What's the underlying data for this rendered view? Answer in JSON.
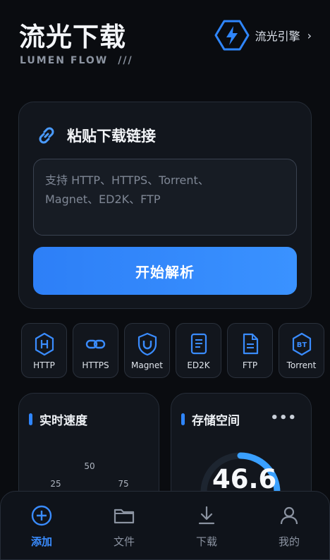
{
  "header": {
    "title": "流光下载",
    "subtitle": "LUMEN FLOW",
    "subtitle_mark": "///",
    "engine_label": "流光引擎",
    "engine_chevron": "›"
  },
  "paste": {
    "title": "粘贴下载链接",
    "placeholder_line1": "支持 HTTP、HTTPS、Torrent、",
    "placeholder_line2": "Magnet、ED2K、FTP",
    "parse_button": "开始解析"
  },
  "protocols": [
    {
      "label": "HTTP",
      "icon": "http-hex-icon"
    },
    {
      "label": "HTTPS",
      "icon": "link-icon"
    },
    {
      "label": "Magnet",
      "icon": "magnet-shield-icon"
    },
    {
      "label": "ED2K",
      "icon": "document-icon"
    },
    {
      "label": "FTP",
      "icon": "file-icon"
    },
    {
      "label": "Torrent",
      "icon": "bt-hex-icon"
    }
  ],
  "speed": {
    "title": "实时速度",
    "ticks": [
      "25",
      "50",
      "75"
    ]
  },
  "storage": {
    "title": "存储空间",
    "more": "•••",
    "value": "46.6",
    "fill_fraction": 0.3
  },
  "tabbar": {
    "items": [
      {
        "label": "添加",
        "active": true
      },
      {
        "label": "文件",
        "active": false
      },
      {
        "label": "下载",
        "active": false
      },
      {
        "label": "我的",
        "active": false
      }
    ]
  },
  "colors": {
    "accent": "#2f86ff",
    "background": "#0a0c10",
    "card": "#12161d"
  }
}
